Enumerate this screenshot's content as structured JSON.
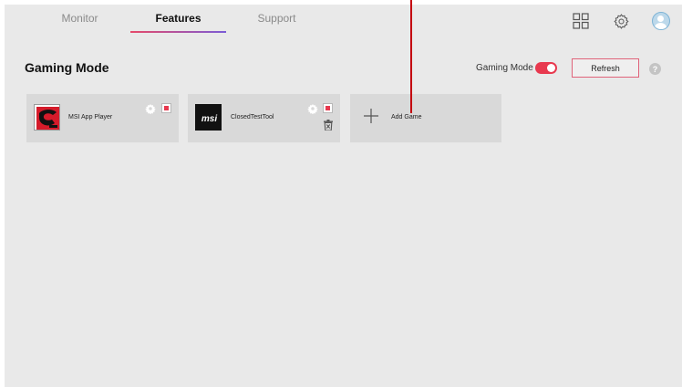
{
  "nav": {
    "tabs": [
      {
        "label": "Monitor",
        "active": false
      },
      {
        "label": "Features",
        "active": true
      },
      {
        "label": "Support",
        "active": false
      }
    ]
  },
  "header": {
    "title": "Gaming Mode",
    "mode_label": "Gaming Mode",
    "mode_enabled": true,
    "refresh_label": "Refresh",
    "help_label": "?"
  },
  "games": [
    {
      "name": "MSI App Player",
      "icon": "msi-app-player-icon"
    },
    {
      "name": "ClosedTestTool",
      "icon": "msi-logo-icon",
      "thumb_text": "msi"
    }
  ],
  "add_game": {
    "label": "Add Game"
  },
  "colors": {
    "accent_red": "#e8394f",
    "tab_gradient_start": "#e64a6a",
    "tab_gradient_end": "#7b5cd6",
    "background": "#e9e9e9",
    "card": "#d9d9d9",
    "annotation": "#c4000f"
  }
}
